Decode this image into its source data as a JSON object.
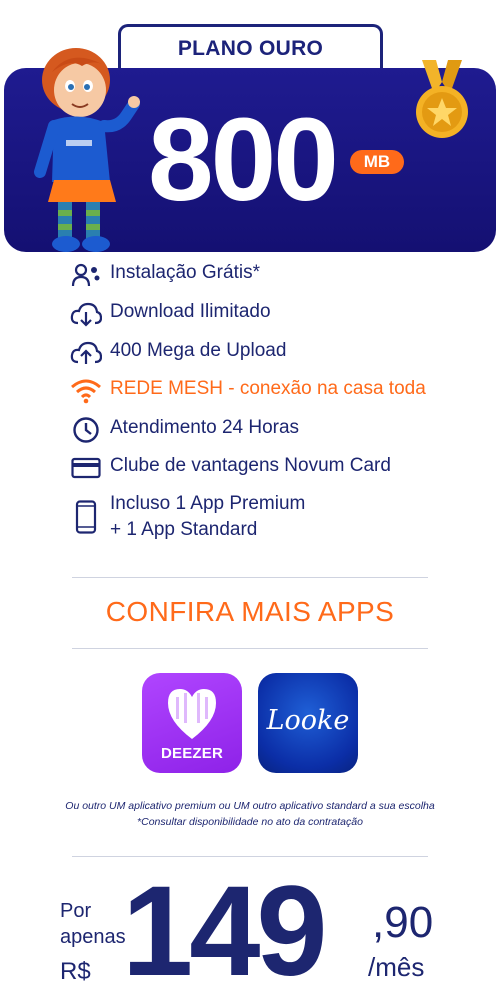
{
  "plan": {
    "name": "PLANO OURO",
    "speed": "800",
    "unit": "MB"
  },
  "features": [
    {
      "icon": "installer-gears-icon",
      "text": "Instalação Grátis*"
    },
    {
      "icon": "cloud-download-icon",
      "text": "Download Ilimitado"
    },
    {
      "icon": "cloud-upload-icon",
      "text": "400 Mega de Upload"
    },
    {
      "icon": "wifi-icon",
      "text": "REDE MESH - conexão na casa toda",
      "highlight": true
    },
    {
      "icon": "clock-icon",
      "text": "Atendimento 24 Horas"
    },
    {
      "icon": "credit-card-icon",
      "text": "Clube de vantagens Novum Card"
    },
    {
      "icon": "smartphone-icon",
      "text": "Incluso 1 App Premium",
      "text2": "+ 1 App Standard"
    }
  ],
  "more_apps": {
    "title": "CONFIRA MAIS APPS",
    "apps": [
      {
        "name": "DEEZER",
        "color": "#a233f5"
      },
      {
        "name": "Looke",
        "color": "#0b2ea7"
      }
    ]
  },
  "notes": {
    "line1": "Ou outro UM aplicativo premium ou UM outro aplicativo standard a sua escolha",
    "line2": "*Consultar disponibilidade no ato da contratação"
  },
  "price": {
    "prefix1": "Por",
    "prefix2": "apenas",
    "currency": "R$",
    "integer": "149",
    "cents": ",90",
    "period": "/mês"
  },
  "colors": {
    "navy": "#1c237a",
    "orange": "#ff6a1a",
    "text": "#1d2670"
  }
}
